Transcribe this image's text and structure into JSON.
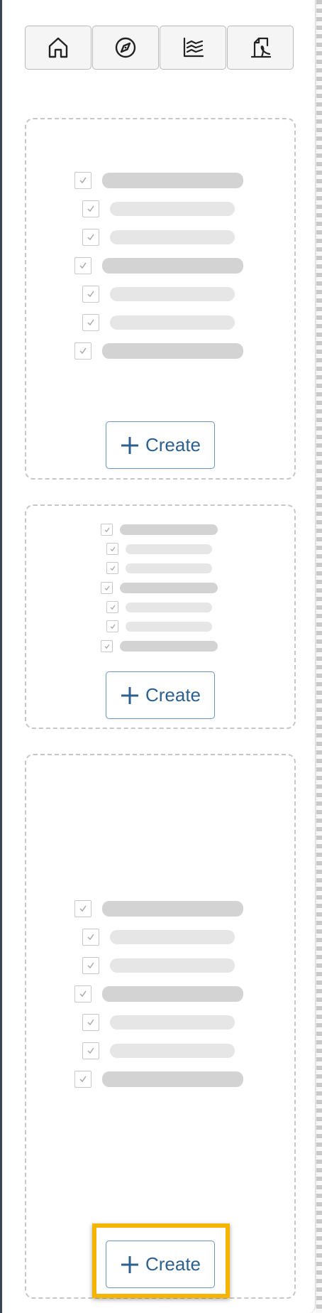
{
  "toolbar": {
    "buttons": [
      {
        "icon": "home-icon",
        "name": "home-button"
      },
      {
        "icon": "compass-icon",
        "name": "explore-button"
      },
      {
        "icon": "line-chart-icon",
        "name": "chart-button"
      },
      {
        "icon": "pdf-document-icon",
        "name": "pdf-button"
      }
    ]
  },
  "cards": [
    {
      "create_label": "Create"
    },
    {
      "create_label": "Create"
    },
    {
      "create_label": "Create"
    }
  ],
  "colors": {
    "accent": "#2d5f8f",
    "highlight": "#f4b400",
    "dashed_border": "#c6c6c6"
  }
}
